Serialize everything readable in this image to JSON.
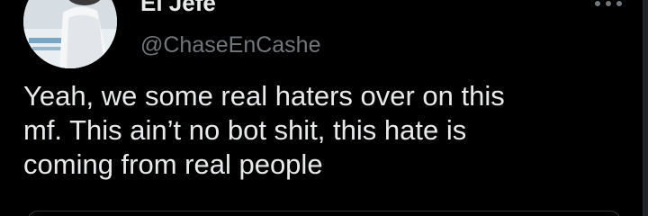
{
  "author": {
    "display_name": "El Jefe",
    "handle": "@ChaseEnCashe"
  },
  "tweet": {
    "lines": [
      "Yeah, we some real haters over on this",
      "mf. This ain’t no bot shit, this hate is",
      "coming from real people"
    ]
  },
  "icons": {
    "more": "more-options-icon"
  },
  "colors": {
    "background": "#000000",
    "text_primary": "#e7e9ea",
    "text_secondary": "#71767b",
    "border": "#2f3336"
  }
}
